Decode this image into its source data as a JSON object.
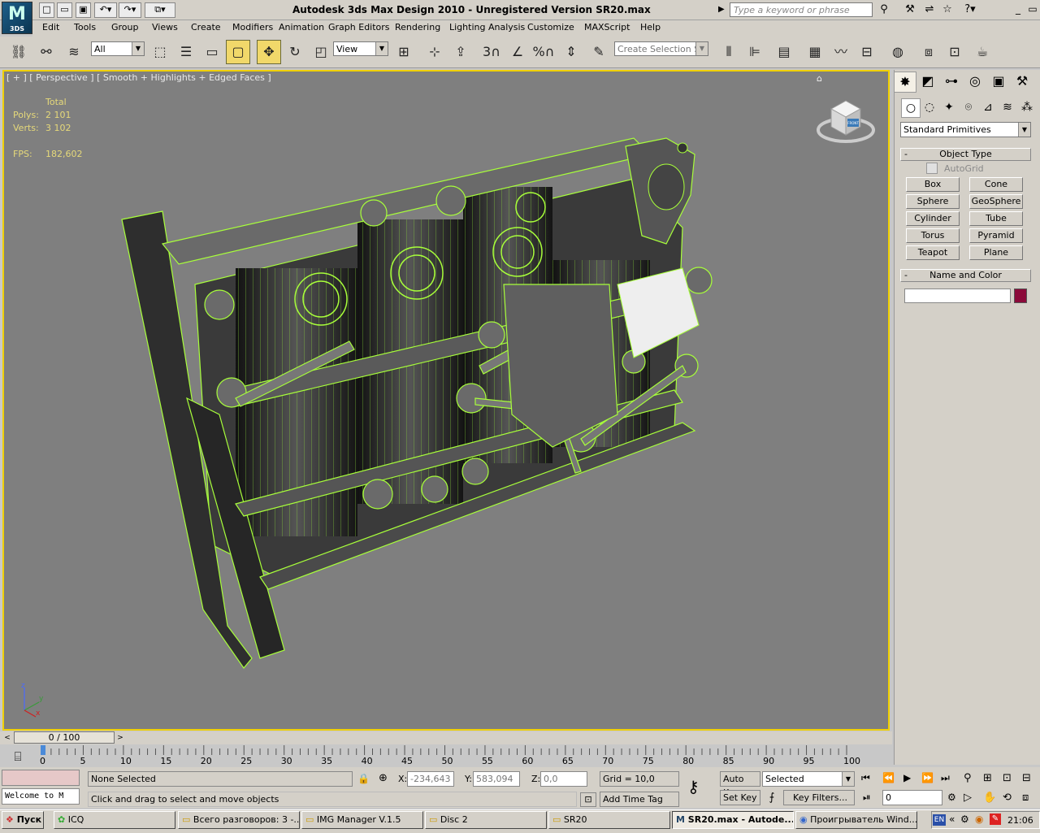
{
  "app": {
    "title": "Autodesk 3ds Max Design 2010  - Unregistered Version    SR20.max",
    "logo_text": "M",
    "logo_sub": "3DS",
    "search_placeholder": "Type a keyword or phrase"
  },
  "menu": [
    "Edit",
    "Tools",
    "Group",
    "Views",
    "Create",
    "Modifiers",
    "Animation",
    "Graph Editors",
    "Rendering",
    "Lighting Analysis",
    "Customize",
    "MAXScript",
    "Help"
  ],
  "toolbar": {
    "selection_filter": "All",
    "ref_coord": "View",
    "named_selection": "Create Selection Se",
    "snaps_label": "3",
    "percent_label": "%"
  },
  "viewport": {
    "label": "[ + ] [ Perspective ] [ Smooth + Highlights + Edged Faces ]",
    "stats": {
      "total_label": "Total",
      "polys_label": "Polys:",
      "polys_value": "2 101",
      "verts_label": "Verts:",
      "verts_value": "3 102",
      "fps_label": "FPS:",
      "fps_value": "182,602"
    },
    "viewcube_face": "FRONT",
    "axis": {
      "z": "z",
      "y": "y",
      "x": "x"
    }
  },
  "command_panel": {
    "dropdown": "Standard Primitives",
    "object_type_title": "Object Type",
    "autogrid": "AutoGrid",
    "buttons": [
      "Box",
      "Cone",
      "Sphere",
      "GeoSphere",
      "Cylinder",
      "Tube",
      "Torus",
      "Pyramid",
      "Teapot",
      "Plane"
    ],
    "name_color_title": "Name and Color",
    "name_value": "",
    "color": "#8b0a3a"
  },
  "timeline": {
    "slider": "0 / 100",
    "ticks": [
      "0",
      "5",
      "10",
      "15",
      "20",
      "25",
      "30",
      "35",
      "40",
      "45",
      "50",
      "55",
      "60",
      "65",
      "70",
      "75",
      "80",
      "85",
      "90",
      "95",
      "100"
    ]
  },
  "status": {
    "selection": "None Selected",
    "prompt": "Click and drag to select and move objects",
    "maxscript": "Welcome to M",
    "x_label": "X:",
    "x_value": "-234,643",
    "y_label": "Y:",
    "y_value": "583,094",
    "z_label": "Z:",
    "z_value": "0,0",
    "grid": "Grid = 10,0",
    "add_time_tag": "Add Time Tag",
    "auto_key": "Auto Key",
    "set_key": "Set Key",
    "key_mode": "Selected",
    "key_filters": "Key Filters...",
    "frame": "0"
  },
  "taskbar": {
    "start": "Пуск",
    "tasks": [
      "ICQ",
      "Всего разговоров: 3 -...",
      "IMG Manager V.1.5",
      "Disc 2",
      "SR20",
      "SR20.max - Autode...",
      "Проигрыватель Wind..."
    ],
    "lang": "EN",
    "clock": "21:06"
  },
  "colors": {
    "viewport_bg": "#7f7f7f",
    "wire": "#a8ff3a",
    "active_border": "#f0d000",
    "stat_text": "#e6d97a"
  }
}
